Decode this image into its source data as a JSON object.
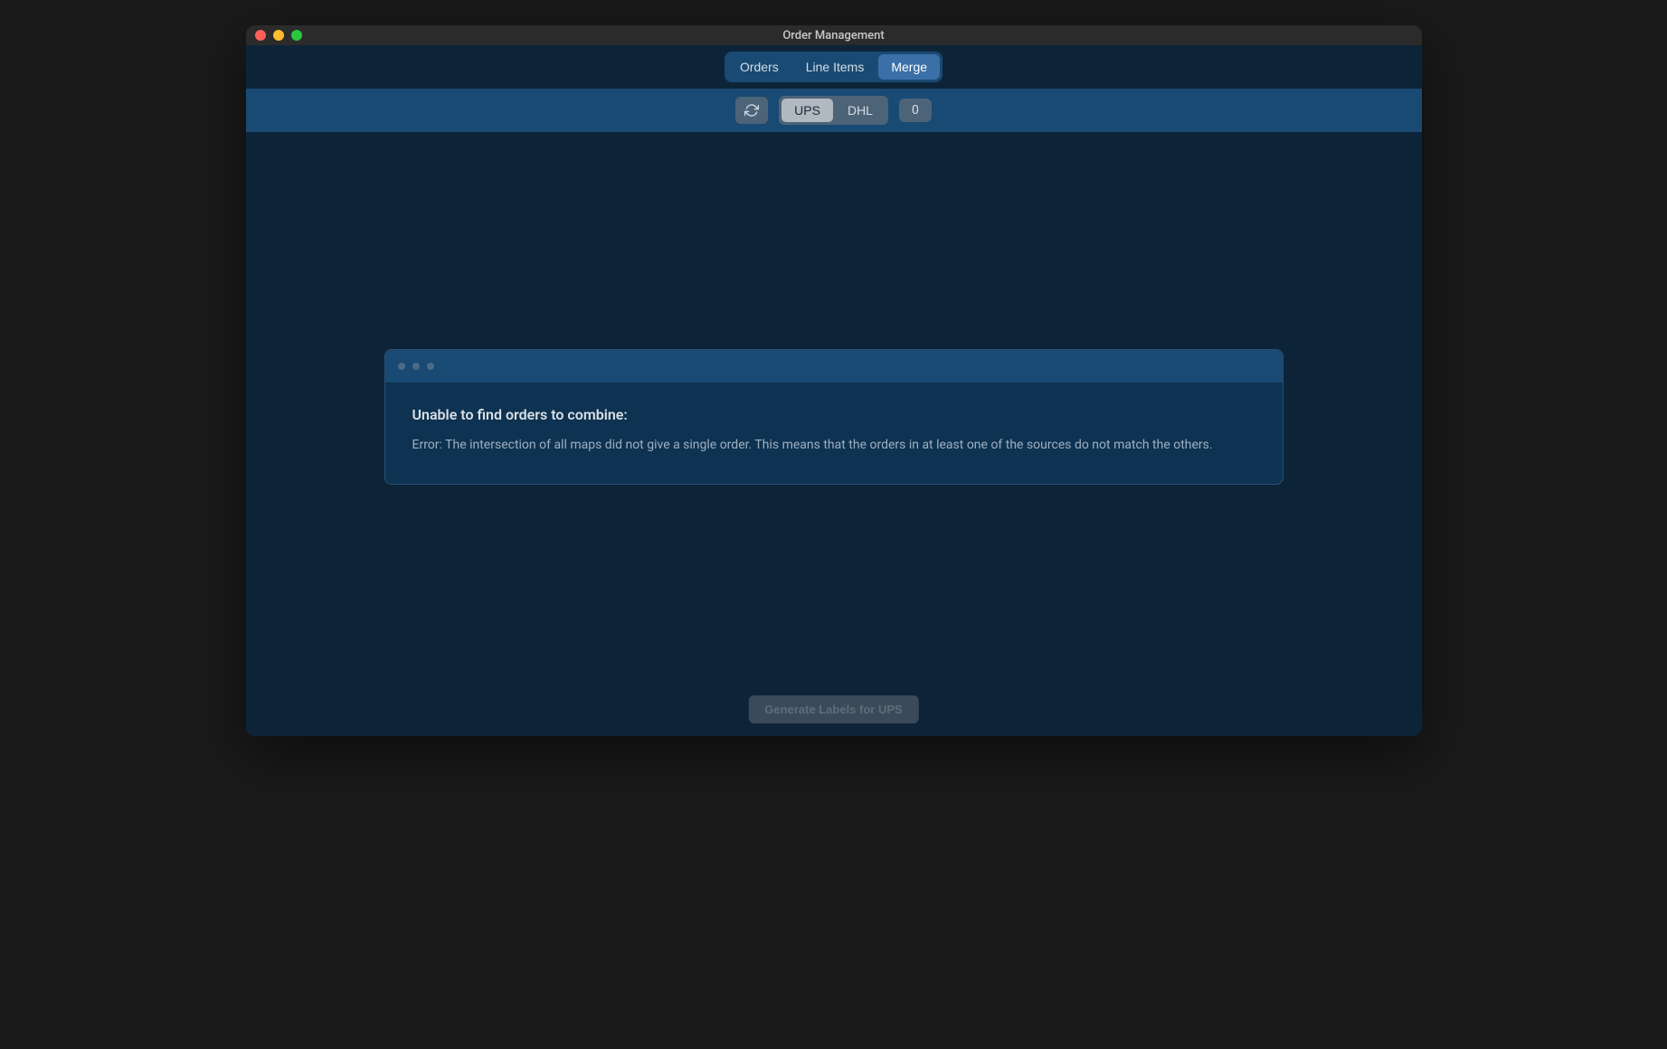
{
  "window": {
    "title": "Order Management"
  },
  "tabs": {
    "items": [
      {
        "label": "Orders",
        "active": false
      },
      {
        "label": "Line Items",
        "active": false
      },
      {
        "label": "Merge",
        "active": true
      }
    ]
  },
  "toolbar": {
    "carriers": [
      {
        "label": "UPS",
        "active": true
      },
      {
        "label": "DHL",
        "active": false
      }
    ],
    "count": "0"
  },
  "error": {
    "title": "Unable to find orders to combine:",
    "message": "Error: The intersection of all maps did not give a single order. This means that the orders in at least one of the sources do not match the others."
  },
  "footer": {
    "button_label": "Generate Labels for UPS"
  }
}
